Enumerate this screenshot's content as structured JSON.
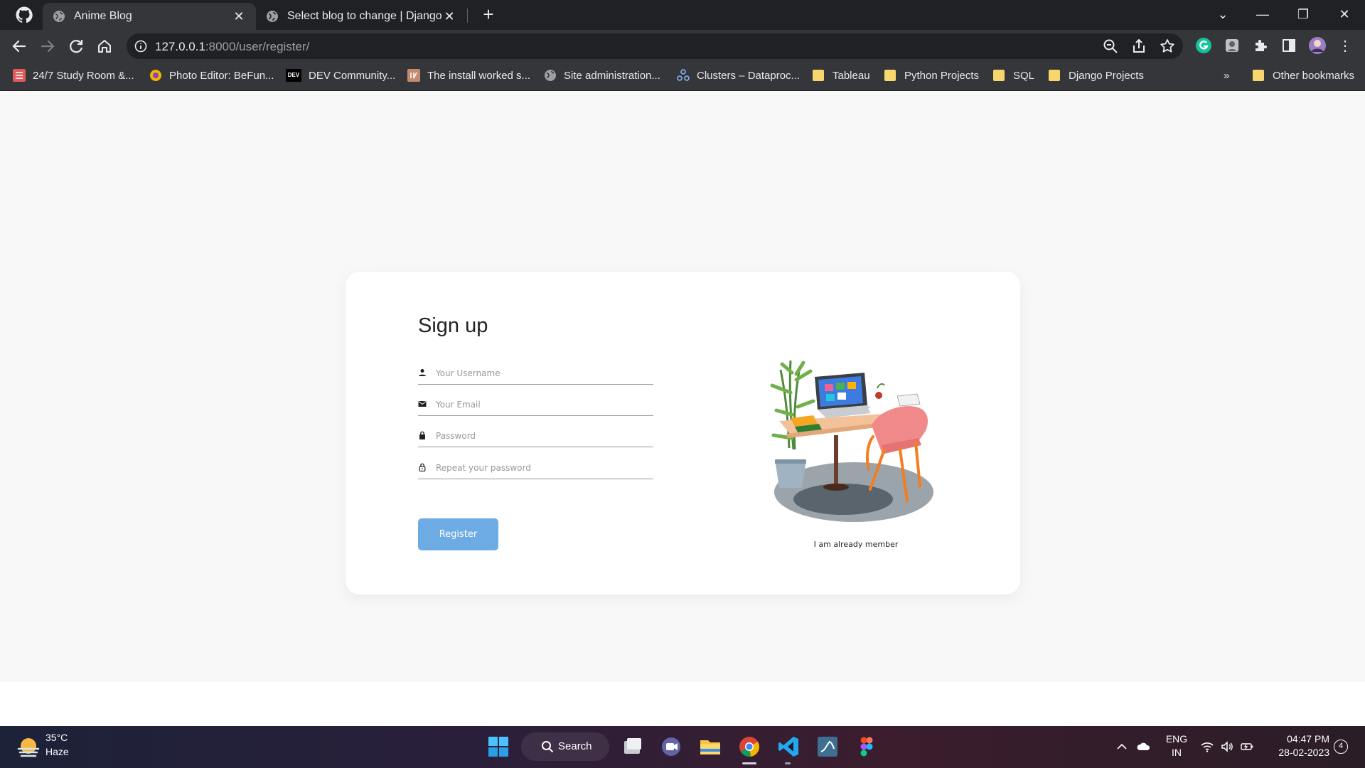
{
  "browser": {
    "tabs": [
      {
        "title": "Anime Blog",
        "active": true
      },
      {
        "title": "Select blog to change | Django si",
        "active": false
      }
    ],
    "url_host": "127.0.0.1",
    "url_rest": ":8000/user/register/",
    "bookmarks": [
      {
        "label": "24/7 Study Room &...",
        "icon": "study-room-icon"
      },
      {
        "label": "Photo Editor: BeFun...",
        "icon": "befunky-icon"
      },
      {
        "label": "DEV Community...",
        "icon": "dev-icon"
      },
      {
        "label": "The install worked s...",
        "icon": "django-icon"
      },
      {
        "label": "Site administration...",
        "icon": "globe-icon"
      },
      {
        "label": "Clusters – Dataproc...",
        "icon": "dataproc-icon"
      },
      {
        "label": "Tableau",
        "icon": "folder-icon"
      },
      {
        "label": "Python Projects",
        "icon": "folder-icon"
      },
      {
        "label": "SQL",
        "icon": "folder-icon"
      },
      {
        "label": "Django Projects",
        "icon": "folder-icon"
      }
    ],
    "overflow": "»",
    "other_bookmarks": "Other bookmarks"
  },
  "signup": {
    "heading": "Sign up",
    "username_placeholder": "Your Username",
    "email_placeholder": "Your Email",
    "password_placeholder": "Password",
    "repeat_placeholder": "Repeat your password",
    "register_label": "Register",
    "member_link": "I am already member",
    "button_color": "#6dabe4"
  },
  "taskbar": {
    "temperature": "35°C",
    "condition": "Haze",
    "search_label": "Search",
    "language": "ENG",
    "region": "IN",
    "time": "04:47 PM",
    "date": "28-02-2023",
    "notification_count": "4"
  }
}
